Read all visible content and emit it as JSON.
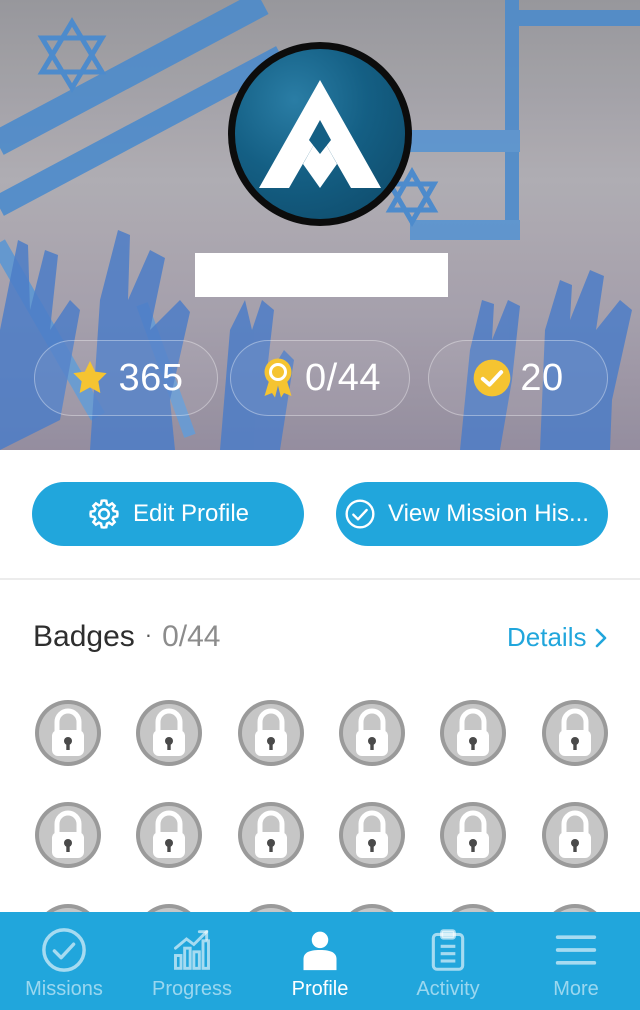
{
  "profile": {
    "stats": {
      "points": "365",
      "badges": "0/44",
      "missions": "20"
    }
  },
  "actions": {
    "edit_profile": "Edit Profile",
    "view_history": "View Mission His..."
  },
  "badges": {
    "title": "Badges",
    "separator": "·",
    "count": "0/44",
    "details": "Details"
  },
  "tabs": [
    {
      "label": "Missions",
      "icon": "check-circle-icon"
    },
    {
      "label": "Progress",
      "icon": "bar-chart-icon"
    },
    {
      "label": "Profile",
      "icon": "person-icon"
    },
    {
      "label": "Activity",
      "icon": "clipboard-icon"
    },
    {
      "label": "More",
      "icon": "menu-icon"
    }
  ],
  "colors": {
    "accent": "#21a6dc",
    "gold": "#f5c431",
    "badge_locked": "#b4b4b4"
  }
}
